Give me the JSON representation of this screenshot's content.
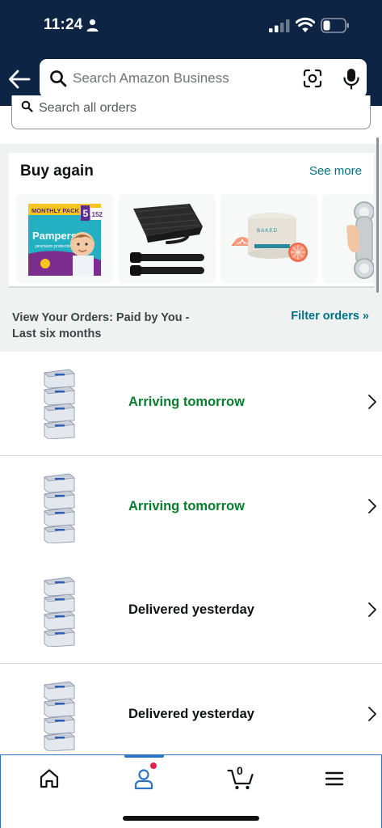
{
  "status_bar": {
    "time": "11:24"
  },
  "header": {
    "search_placeholder": "Search Amazon Business"
  },
  "orders_search": {
    "placeholder": "Search all orders"
  },
  "buy_again": {
    "title": "Buy again",
    "see_more": "See more",
    "pampers": {
      "pack_label": "MONTHLY PACK",
      "size": "5",
      "count": "152",
      "brand": "Pampers",
      "line": "premium protection"
    },
    "jar_label": "BAKED",
    "items": [
      "diapers",
      "cable-ties",
      "body-cream",
      "grab-handle"
    ]
  },
  "orders_filter": {
    "description": "View Your Orders: Paid by You - Last six months",
    "filter_label": "Filter orders »"
  },
  "orders": [
    {
      "status": "Arriving tomorrow",
      "status_color": "#067d2e"
    },
    {
      "status": "Arriving tomorrow",
      "status_color": "#067d2e"
    },
    {
      "status": "Delivered yesterday",
      "status_color": "#0f1111"
    },
    {
      "status": "Delivered yesterday",
      "status_color": "#0f1111"
    }
  ],
  "bottom_nav": {
    "items": [
      "home-icon",
      "account-icon",
      "cart-icon",
      "menu-icon"
    ],
    "cart_count": "0",
    "accent": "#2a73c6"
  },
  "colors": {
    "header_bg": "#0e2444",
    "link": "#007185"
  }
}
